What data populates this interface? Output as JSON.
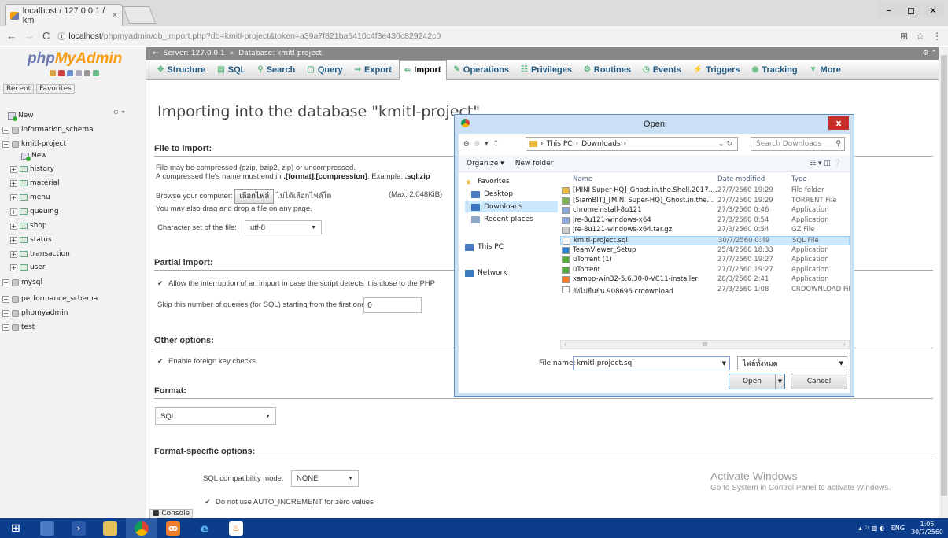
{
  "browser": {
    "tab_title": "localhost / 127.0.0.1 / km",
    "tab_close": "×",
    "url_host": "localhost",
    "url_path": "/phpmyadmin/db_import.php?db=kmitl-project&token=a39a7f821ba6410c4f3e430c829242c0",
    "win_min": "–",
    "win_max": "◻",
    "win_close": "×"
  },
  "nav": {
    "logo_php": "php",
    "logo_my": "MyAdmin",
    "recent": "Recent",
    "favorites": "Favorites",
    "collapse_all": "⊖ ⚭",
    "items": [
      {
        "label": "New"
      },
      {
        "label": "information_schema"
      },
      {
        "label": "kmitl-project"
      },
      {
        "label": "New"
      },
      {
        "label": "history"
      },
      {
        "label": "material"
      },
      {
        "label": "menu"
      },
      {
        "label": "queuing"
      },
      {
        "label": "shop"
      },
      {
        "label": "status"
      },
      {
        "label": "transaction"
      },
      {
        "label": "user"
      },
      {
        "label": "mysql"
      },
      {
        "label": "performance_schema"
      },
      {
        "label": "phpmyadmin"
      },
      {
        "label": "test"
      }
    ]
  },
  "topbar": {
    "server": "Server: 127.0.0.1",
    "sep": "»",
    "database": "Database: kmitl-project",
    "right_icons": "⚙ ⌃"
  },
  "menu": {
    "tabs": [
      {
        "label": "Structure",
        "icon": "✥"
      },
      {
        "label": "SQL",
        "icon": "▤"
      },
      {
        "label": "Search",
        "icon": "⚲"
      },
      {
        "label": "Query",
        "icon": "▢"
      },
      {
        "label": "Export",
        "icon": "⇒"
      },
      {
        "label": "Import",
        "icon": "⇐"
      },
      {
        "label": "Operations",
        "icon": "✎"
      },
      {
        "label": "Privileges",
        "icon": "☷"
      },
      {
        "label": "Routines",
        "icon": "⚙"
      },
      {
        "label": "Events",
        "icon": "◷"
      },
      {
        "label": "Triggers",
        "icon": "⚡"
      },
      {
        "label": "Tracking",
        "icon": "◉"
      },
      {
        "label": "More",
        "icon": "▼"
      }
    ]
  },
  "main": {
    "title": "Importing into the database \"kmitl-project\"",
    "file_section": "File to import:",
    "compress_line1": "File may be compressed (gzip, bzip2, zip) or uncompressed.",
    "compress_line2": "A compressed file's name must end in ",
    "compress_format": ".[format].[compression]",
    "compress_example_lbl": ". Example: ",
    "compress_example": ".sql.zip",
    "browse_label": "Browse your computer:",
    "choose_file_btn": "เลือกไฟล์",
    "no_file_chosen": "ไม่ได้เลือกไฟล์ใด",
    "max_size": "(Max: 2,048KiB)",
    "drag_drop": "You may also drag and drop a file on any page.",
    "charset_label": "Character set of the file:",
    "charset_value": "utf-8",
    "partial_section": "Partial import:",
    "allow_interrupt": "Allow the interruption of an import in case the script detects it is close to the PHP",
    "skip_label": "Skip this number of queries (for SQL) starting from the first one:",
    "skip_value": "0",
    "other_section": "Other options:",
    "foreign_key": "Enable foreign key checks",
    "format_section": "Format:",
    "format_value": "SQL",
    "format_specific_section": "Format-specific options:",
    "compat_label": "SQL compatibility mode:",
    "compat_value": "NONE",
    "auto_increment": "Do not use AUTO_INCREMENT for zero values",
    "checkmark": "✔",
    "console": "Console"
  },
  "activate": {
    "line1": "Activate Windows",
    "line2": "Go to System in Control Panel to activate Windows."
  },
  "dialog": {
    "title": "Open",
    "close": "x",
    "crumb_this_pc": "This PC",
    "crumb_downloads": "Downloads",
    "crumb_sep": "›",
    "search_placeholder": "Search Downloads",
    "organize": "Organize ▾",
    "new_folder": "New folder",
    "view_icons": "☷ ▾ ◫ ❔",
    "places": [
      {
        "label": "Favorites"
      },
      {
        "label": "Desktop"
      },
      {
        "label": "Downloads"
      },
      {
        "label": "Recent places"
      },
      {
        "label": "This PC"
      },
      {
        "label": "Network"
      }
    ],
    "headers": {
      "name": "Name",
      "date": "Date modified",
      "type": "Type"
    },
    "files": [
      {
        "name": "[MINI Super-HQ]_Ghost.in.the.Shell.2017....",
        "date": "27/7/2560 19:29",
        "type": "File folder",
        "color": "#e8b93a"
      },
      {
        "name": "[SiamBIT]_[MINI Super-HQ]_Ghost.in.the...",
        "date": "27/7/2560 19:29",
        "type": "TORRENT File",
        "color": "#77b255"
      },
      {
        "name": "chromeinstall-8u121",
        "date": "27/3/2560 0:46",
        "type": "Application",
        "color": "#8aa8d8"
      },
      {
        "name": "jre-8u121-windows-x64",
        "date": "27/3/2560 0:54",
        "type": "Application",
        "color": "#8aa8d8"
      },
      {
        "name": "jre-8u121-windows-x64.tar.gz",
        "date": "27/3/2560 0:54",
        "type": "GZ File",
        "color": "#cccccc"
      },
      {
        "name": "kmitl-project.sql",
        "date": "30/7/2560 0:49",
        "type": "SQL File",
        "color": "#ffffff"
      },
      {
        "name": "TeamViewer_Setup",
        "date": "25/4/2560 18:33",
        "type": "Application",
        "color": "#2d7fd3"
      },
      {
        "name": "uTorrent (1)",
        "date": "27/7/2560 19:27",
        "type": "Application",
        "color": "#56a93d"
      },
      {
        "name": "uTorrent",
        "date": "27/7/2560 19:27",
        "type": "Application",
        "color": "#56a93d"
      },
      {
        "name": "xampp-win32-5.6.30-0-VC11-installer",
        "date": "28/3/2560 2:41",
        "type": "Application",
        "color": "#f37d2a"
      },
      {
        "name": "ยังไม่ยืนยัน 908696.crdownload",
        "date": "27/3/2560 1:08",
        "type": "CRDOWNLOAD File",
        "color": "#ffffff"
      }
    ],
    "hscroll_mid": "III",
    "file_name_label": "File name:",
    "file_name_value": "kmitl-project.sql",
    "file_type_value": "ไฟล์ทั้งหมด",
    "open_btn": "Open",
    "cancel_btn": "Cancel"
  },
  "taskbar": {
    "lang": "ENG",
    "time": "1:05",
    "date": "30/7/2560",
    "tray_icons": "▴ ⚐ ▥ ◐"
  }
}
